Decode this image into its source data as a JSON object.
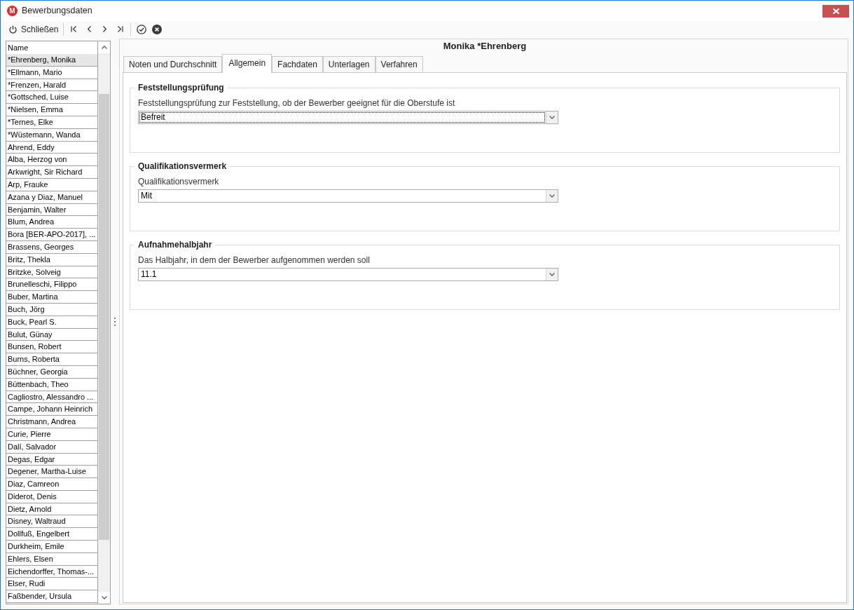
{
  "window": {
    "logo": "M",
    "title": "Bewerbungsdaten"
  },
  "toolbar": {
    "close_label": "Schließen"
  },
  "list": {
    "column": "Name",
    "rows": [
      {
        "name": "*Ehrenberg, Monika",
        "selected": true
      },
      {
        "name": "*Ellmann, Mario",
        "selected": false
      },
      {
        "name": "*Frenzen, Harald",
        "selected": false
      },
      {
        "name": "*Gottsched, Luise",
        "selected": false
      },
      {
        "name": "*Nielsen, Emma",
        "selected": false
      },
      {
        "name": "*Ternes, Elke",
        "selected": false
      },
      {
        "name": "*Wüstemann, Wanda",
        "selected": false
      },
      {
        "name": "Ahrend, Eddy",
        "selected": false
      },
      {
        "name": "Alba, Herzog von",
        "selected": false
      },
      {
        "name": "Arkwright, Sir Richard",
        "selected": false
      },
      {
        "name": "Arp, Frauke",
        "selected": false
      },
      {
        "name": "Azana y Diaz, Manuel",
        "selected": false
      },
      {
        "name": "Benjamin, Walter",
        "selected": false
      },
      {
        "name": "Blum, Andrea",
        "selected": false
      },
      {
        "name": "Bora [BER-APO-2017], ...",
        "selected": false
      },
      {
        "name": "Brassens, Georges",
        "selected": false
      },
      {
        "name": "Britz, Thekla",
        "selected": false
      },
      {
        "name": "Britzke, Solveig",
        "selected": false
      },
      {
        "name": "Brunelleschi, Filippo",
        "selected": false
      },
      {
        "name": "Buber, Martina",
        "selected": false
      },
      {
        "name": "Buch, Jörg",
        "selected": false
      },
      {
        "name": "Buck, Pearl S.",
        "selected": false
      },
      {
        "name": "Bulut, Günay",
        "selected": false
      },
      {
        "name": "Bunsen, Robert",
        "selected": false
      },
      {
        "name": "Burns, Roberta",
        "selected": false
      },
      {
        "name": "Büchner, Georgia",
        "selected": false
      },
      {
        "name": "Büttenbach, Theo",
        "selected": false
      },
      {
        "name": "Cagliostro, Alessandro ...",
        "selected": false
      },
      {
        "name": "Campe, Johann Heinrich",
        "selected": false
      },
      {
        "name": "Christmann, Andrea",
        "selected": false
      },
      {
        "name": "Curie, Pierre",
        "selected": false
      },
      {
        "name": "Dalí, Salvador",
        "selected": false
      },
      {
        "name": "Degas, Edgar",
        "selected": false
      },
      {
        "name": "Degener, Martha-Luise",
        "selected": false
      },
      {
        "name": "Diaz, Camreon",
        "selected": false
      },
      {
        "name": "Diderot, Denis",
        "selected": false
      },
      {
        "name": "Dietz, Arnold",
        "selected": false
      },
      {
        "name": "Disney, Waltraud",
        "selected": false
      },
      {
        "name": "Dollfuß, Engelbert",
        "selected": false
      },
      {
        "name": "Durkheim, Emile",
        "selected": false
      },
      {
        "name": "Ehlers, Elsen",
        "selected": false
      },
      {
        "name": "Eichendorffer, Thomas-...",
        "selected": false
      },
      {
        "name": "Elser, Rudi",
        "selected": false
      },
      {
        "name": "Faßbender, Ursula",
        "selected": false
      }
    ]
  },
  "detail": {
    "heading": "Monika *Ehrenberg",
    "tabs": [
      {
        "label": "Noten und Durchschnitt",
        "selected": false
      },
      {
        "label": "Allgemein",
        "selected": true
      },
      {
        "label": "Fachdaten",
        "selected": false
      },
      {
        "label": "Unterlagen",
        "selected": false
      },
      {
        "label": "Verfahren",
        "selected": false
      }
    ],
    "groups": [
      {
        "title": "Feststellungsprüfung",
        "label": "Feststellungsprüfung zur Feststellung, ob der Bewerber geeignet für die Oberstufe ist",
        "value": "Befreit",
        "focused": true
      },
      {
        "title": "Qualifikationsvermerk",
        "label": "Qualifikationsvermerk",
        "value": "Mit",
        "focused": false
      },
      {
        "title": "Aufnahmehalbjahr",
        "label": "Das Halbjahr, in dem der Bewerber aufgenommen werden soll",
        "value": "11.1",
        "focused": false
      }
    ]
  }
}
